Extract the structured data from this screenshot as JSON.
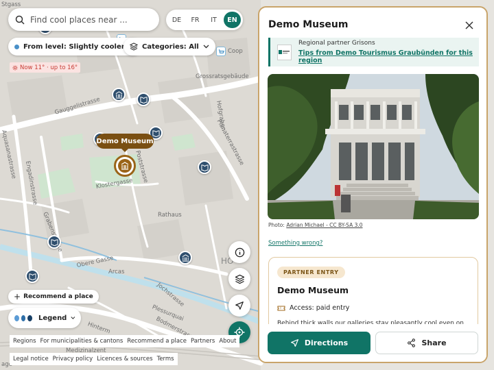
{
  "map": {
    "search_placeholder": "Find cool places near ...",
    "languages": [
      "DE",
      "FR",
      "IT",
      "EN"
    ],
    "active_language": "EN",
    "level_filter": "From level: Slightly cooler",
    "categories_filter": "Categories: All",
    "temperature": "Now 11° · up to 16°",
    "selected_marker_label": "Demo Museum",
    "streets": {
      "gauggelistrasse": "Gauggelistrasse",
      "aquasanastrasse": "Aquasanastrasse",
      "engadinstrasse": "Engadinstrasse",
      "grabenstrasse": "Grabenstrasse",
      "klostergasse": "Klostergasse",
      "poststrasse": "Poststrasse",
      "rathaus": "Rathaus",
      "planaterrastrasse": "Planaterrastrasse",
      "hofgraben": "Hofgraben",
      "grossratsgebaeude": "Grossratsgebäude",
      "coop": "Coop",
      "obere_gasse": "Obere Gasse",
      "arcas": "Arcas",
      "jochstrasse": "Jochstrasse",
      "plessurquai": "Plessurquai",
      "bodmerstrasse": "Bodmerstrasse",
      "hinterm_bach": "Hinterm",
      "medizinalzentrum": "Medizinalzent",
      "hof": "HO",
      "age": "age",
      "stgass": "Stgass"
    },
    "recommend_place": "Recommend a place",
    "legend_label": "Legend",
    "legend_colors": [
      "#5b9bd5",
      "#2e6fa8",
      "#173f66"
    ],
    "footer_links_1": [
      "Regions",
      "For municipalities & cantons",
      "Recommend a place",
      "Partners",
      "About"
    ],
    "footer_links_2": [
      "Legal notice",
      "Privacy policy",
      "Licences & sources",
      "Terms"
    ]
  },
  "panel": {
    "title": "Demo Museum",
    "partner_label": "Regional partner Grisons",
    "partner_link": "Tips from Demo Tourismus Graubünden for this region",
    "photo_credit_prefix": "Photo: ",
    "photo_credit_link": "Adrian Michael - CC BY-SA 3.0",
    "something_wrong": "Something wrong?",
    "card": {
      "badge": "PARTNER ENTRY",
      "title": "Demo Museum",
      "access": "Access: paid entry",
      "description": "Behind thick walls our galleries stay pleasantly cool even on hot"
    },
    "directions_label": "Directions",
    "share_label": "Share"
  },
  "colors": {
    "accent": "#107466",
    "marker": "#9a6418",
    "poi": "#2f4f6e"
  }
}
